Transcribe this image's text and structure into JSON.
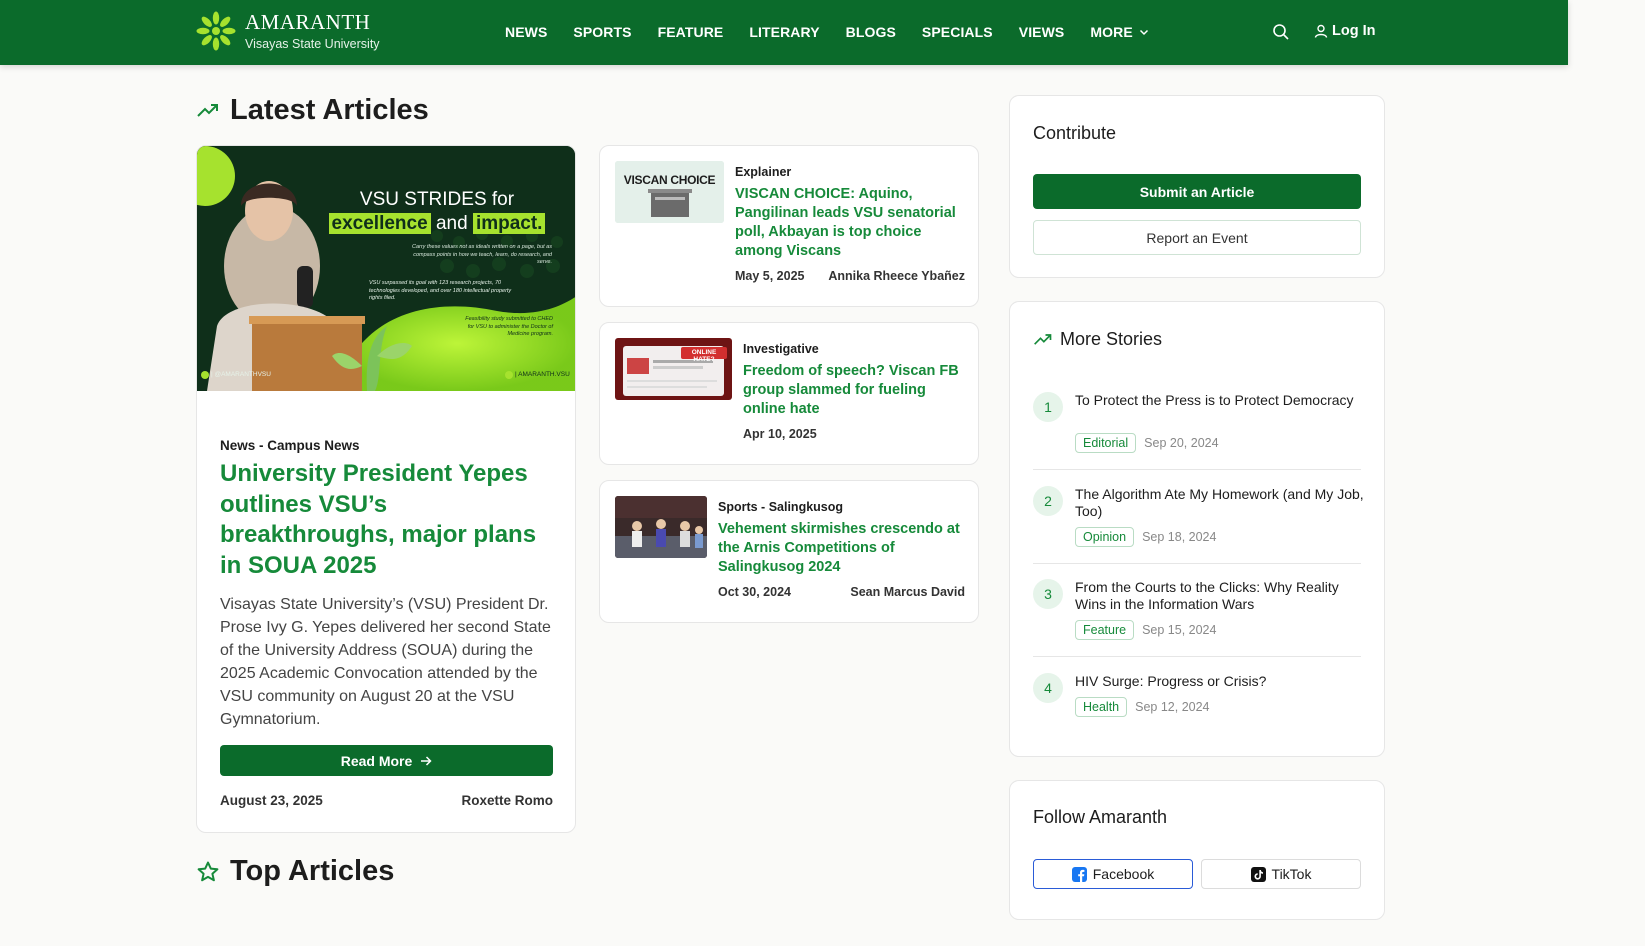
{
  "brand": {
    "name": "AMARANTH",
    "subtitle": "Visayas State University"
  },
  "nav": [
    "NEWS",
    "SPORTS",
    "FEATURE",
    "LITERARY",
    "BLOGS",
    "SPECIALS",
    "VIEWS",
    "MORE"
  ],
  "header": {
    "login_label": "Log In"
  },
  "sections": {
    "latest": "Latest Articles",
    "top": "Top Articles"
  },
  "featured": {
    "image_text": {
      "line1": "VSU STRIDES for",
      "highlight1": "excellence",
      "and": "and",
      "highlight2": "impact.",
      "para1": "Carry these values not as ideals written on a page, but as compass points in how we teach, learn, do research, and serve.",
      "para2": "VSU surpassed its goal with 123 research projects, 70 technologies developed, and over 180 intellectual property rights filed.",
      "para3": "Feasibility study submitted to CHED for VSU to administer the Doctor of Medicine program.",
      "handle_left": "| @AMARANTHVSU",
      "handle_right": "| AMARANTH.VSU"
    },
    "category": "News - Campus News",
    "title": "University President Yepes outlines VSU’s breakthroughs, major plans in SOUA 2025",
    "excerpt": "Visayas State University’s (VSU) President Dr. Prose Ivy G. Yepes delivered her second State of the University Address (SOUA) during the 2025 Academic Convocation attended by the VSU community on August 20 at the VSU Gymnatorium.",
    "read_more": "Read More",
    "date": "August 23, 2025",
    "author": "Roxette Romo"
  },
  "articles": [
    {
      "category": "Explainer",
      "title": "VISCAN CHOICE: Aquino, Pangilinan leads VSU senatorial poll, Akbayan is top choice among Viscans",
      "date": "May 5, 2025",
      "author": "Annika Rheece Ybañez",
      "thumb_text": "VISCAN CHOICE"
    },
    {
      "category": "Investigative",
      "title": "Freedom of speech? Viscan FB group slammed for fueling online hate",
      "date": "Apr 10, 2025",
      "author": "",
      "thumb_text": "ONLINE HATE?"
    },
    {
      "category": "Sports - Salingkusog",
      "title": "Vehement skirmishes crescendo at the Arnis Competitions of Salingkusog 2024",
      "date": "Oct 30, 2024",
      "author": "Sean Marcus David",
      "thumb_text": ""
    }
  ],
  "contribute": {
    "title": "Contribute",
    "submit": "Submit an Article",
    "report": "Report an Event"
  },
  "more_stories": {
    "title": "More Stories",
    "items": [
      {
        "num": "1",
        "title": "To Protect the Press is to Protect Democracy",
        "tag": "Editorial",
        "date": "Sep 20, 2024"
      },
      {
        "num": "2",
        "title": "The Algorithm Ate My Homework (and My Job, Too)",
        "tag": "Opinion",
        "date": "Sep 18, 2024"
      },
      {
        "num": "3",
        "title": "From the Courts to the Clicks: Why Reality Wins in the Information Wars",
        "tag": "Feature",
        "date": "Sep 15, 2024"
      },
      {
        "num": "4",
        "title": "HIV Surge: Progress or Crisis?",
        "tag": "Health",
        "date": "Sep 12, 2024"
      }
    ]
  },
  "follow": {
    "title": "Follow Amaranth",
    "facebook": "Facebook",
    "tiktok": "TikTok"
  },
  "colors": {
    "brand_green": "#0b6b2b",
    "link_green": "#168a3a",
    "lime": "#a6e22e"
  },
  "icons": [
    "amaranth-logo-icon",
    "chevron-down-icon",
    "search-icon",
    "user-icon",
    "trend-icon",
    "star-icon",
    "arrow-right-icon",
    "facebook-icon",
    "tiktok-icon"
  ]
}
